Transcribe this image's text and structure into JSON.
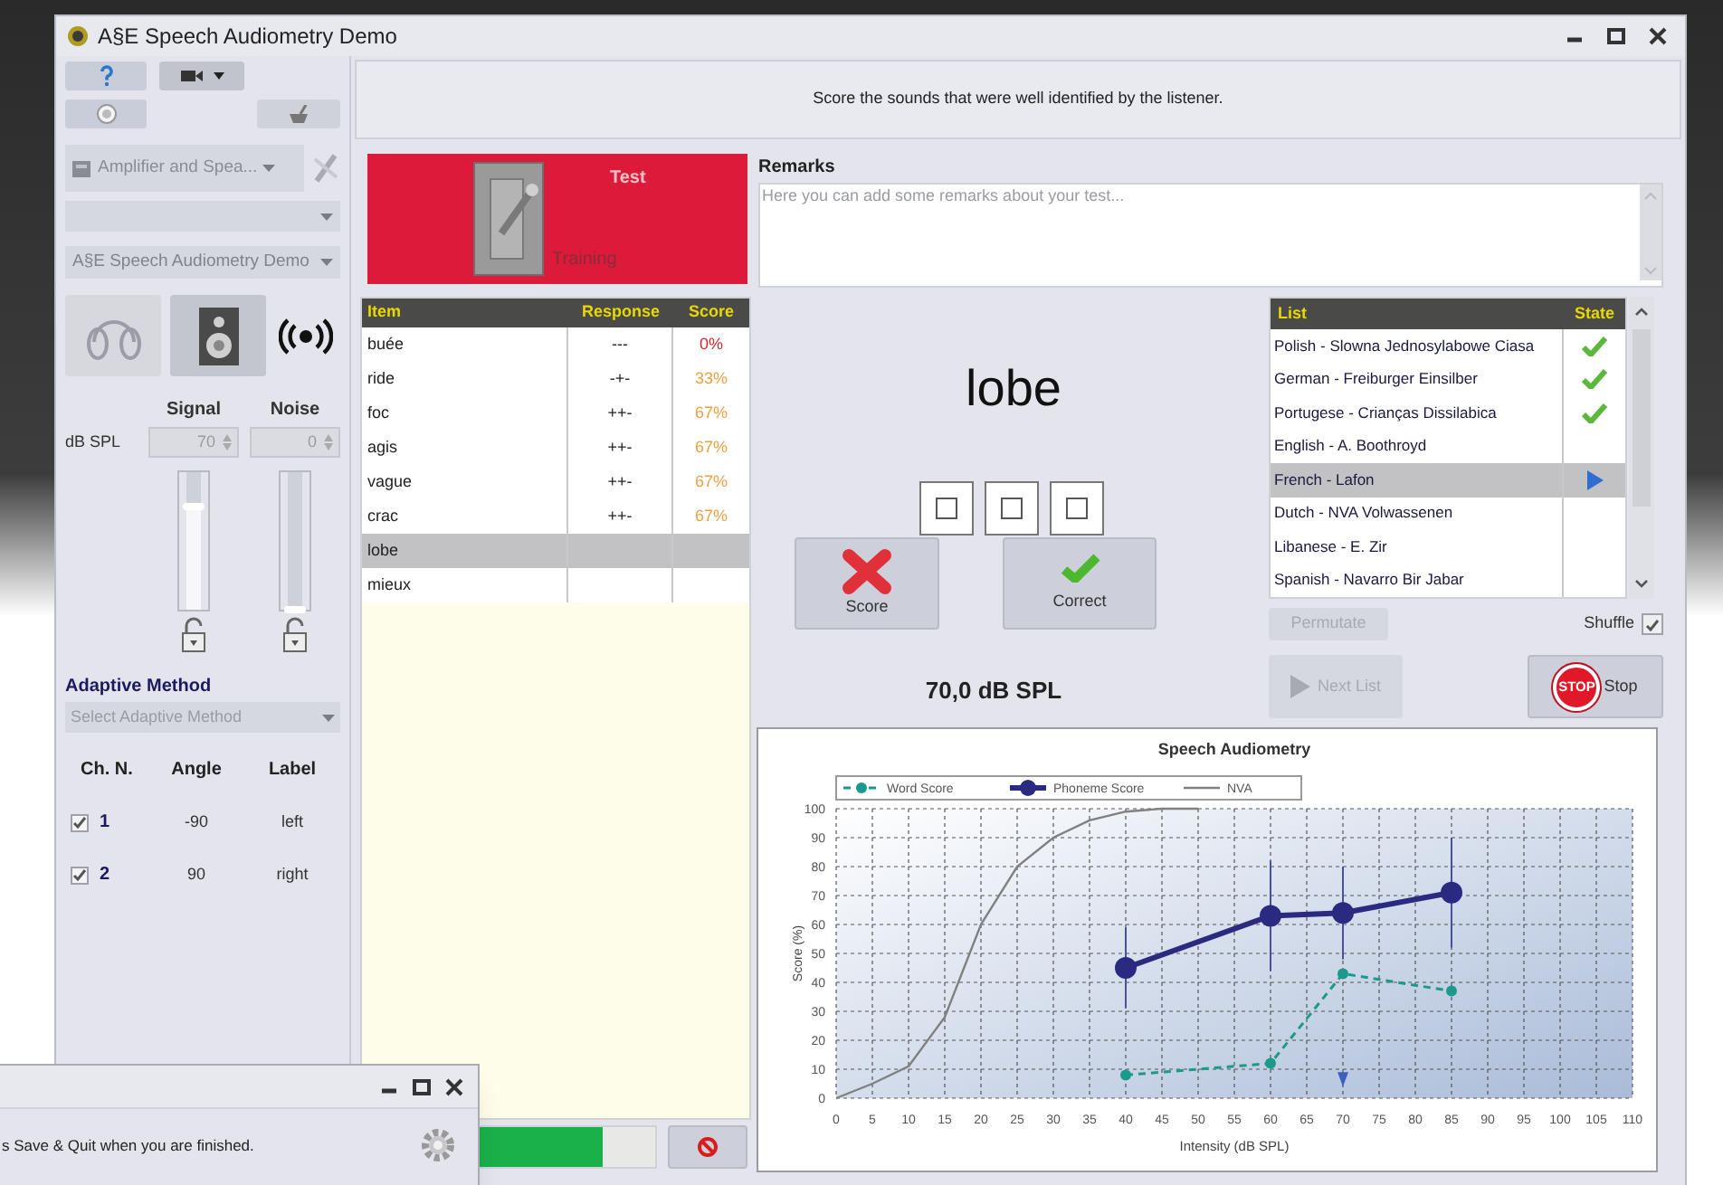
{
  "window": {
    "title": "A§E Speech Audiometry Demo"
  },
  "instruction": "Score the sounds that were well identified by the listener.",
  "left_panel": {
    "device_dropdown": "Amplifier and Spea...",
    "profile_dropdown": "A§E Speech Audiometry Demo",
    "outputs": [
      {
        "kind": "headphones",
        "selected": false
      },
      {
        "kind": "speaker",
        "selected": true
      }
    ],
    "levels": {
      "unit": "dB SPL",
      "channels": [
        {
          "label": "Signal",
          "value": "70",
          "level": 0.75
        },
        {
          "label": "Noise",
          "value": "0",
          "level": 0
        }
      ]
    },
    "adaptive_method": {
      "label": "Adaptive Method",
      "placeholder": "Select Adaptive Method"
    },
    "channel_table": {
      "columns": [
        "Ch. N.",
        "Angle",
        "Label"
      ],
      "rows": [
        {
          "checked": true,
          "number": "1",
          "angle": "-90",
          "label": "left"
        },
        {
          "checked": true,
          "number": "2",
          "angle": "90",
          "label": "right"
        }
      ]
    }
  },
  "mode_switch": {
    "options": [
      {
        "label": "Test",
        "selected": true
      },
      {
        "label": "Training",
        "selected": false
      }
    ]
  },
  "remarks": {
    "label": "Remarks",
    "placeholder": "Here you can add some remarks about your test..."
  },
  "items": {
    "columns": [
      "Item",
      "Response",
      "Score"
    ],
    "rows": [
      {
        "item": "buée",
        "response": "---",
        "score": "0%",
        "color": "#d42a2a",
        "selected": false
      },
      {
        "item": "ride",
        "response": "-+-",
        "score": "33%",
        "color": "#f0a040",
        "selected": false
      },
      {
        "item": "foc",
        "response": "++-",
        "score": "67%",
        "color": "#f0a040",
        "selected": false
      },
      {
        "item": "agis",
        "response": "++-",
        "score": "67%",
        "color": "#f0a040",
        "selected": false
      },
      {
        "item": "vague",
        "response": "++-",
        "score": "67%",
        "color": "#f0a040",
        "selected": false
      },
      {
        "item": "crac",
        "response": "++-",
        "score": "67%",
        "color": "#f0a040",
        "selected": false
      },
      {
        "item": "lobe",
        "selected": true
      },
      {
        "item": "mieux",
        "selected": false
      }
    ]
  },
  "progress": {
    "level": 0.82
  },
  "current_word": "lobe",
  "phoneme_boxes": [
    {
      "checked": false
    },
    {
      "checked": false
    },
    {
      "checked": false
    }
  ],
  "score_button": "Score",
  "correct_button": "Correct",
  "intensity": "70,0 dB SPL",
  "lists": {
    "columns": [
      "List",
      "State"
    ],
    "rows": [
      {
        "name": "Polish - Slowna Jednosylabowe Ciasa",
        "done": true,
        "current": false,
        "selected": false
      },
      {
        "name": "German - Freiburger Einsilber",
        "done": true,
        "current": false,
        "selected": false
      },
      {
        "name": "Portugese - Crianças Dissilabica",
        "done": true,
        "current": false,
        "selected": false
      },
      {
        "name": "English - A. Boothroyd",
        "done": false,
        "current": false,
        "selected": false
      },
      {
        "name": "French - Lafon",
        "done": false,
        "current": true,
        "selected": true
      },
      {
        "name": "Dutch - NVA Volwassenen",
        "done": false,
        "current": false,
        "selected": false
      },
      {
        "name": "Libanese - E. Zir",
        "done": false,
        "current": false,
        "selected": false
      },
      {
        "name": "Spanish - Navarro Bir Jabar",
        "done": false,
        "current": false,
        "selected": false
      }
    ]
  },
  "permutate": {
    "label": "Permutate",
    "disabled": true
  },
  "shuffle": {
    "label": "Shuffle",
    "checked": true
  },
  "next_list": {
    "label": "Next List",
    "disabled": true
  },
  "stop": {
    "label": "Stop",
    "sign": "STOP"
  },
  "chart": {
    "chart_data": {
      "type": "line",
      "title": "Speech Audiometry",
      "xlabel": "Intensity (dB SPL)",
      "ylabel": "Score (%)",
      "x": [
        0,
        5,
        10,
        15,
        20,
        25,
        30,
        35,
        40,
        45,
        50,
        60,
        70,
        85
      ],
      "series": [
        {
          "name": "Word Score",
          "color": "#1a9a8a",
          "line_style": "dashed",
          "marker": "circle",
          "values": [
            null,
            null,
            null,
            null,
            null,
            null,
            null,
            null,
            8,
            null,
            null,
            12,
            43,
            37
          ]
        },
        {
          "name": "Phoneme Score",
          "color": "#2a2a80",
          "line_style": "solid",
          "marker": "circle",
          "values": [
            null,
            null,
            null,
            null,
            null,
            null,
            null,
            null,
            45,
            null,
            null,
            63,
            64,
            71
          ],
          "errors": [
            null,
            null,
            null,
            null,
            null,
            null,
            null,
            null,
            14,
            null,
            null,
            19,
            16,
            19
          ]
        },
        {
          "name": "NVA",
          "color": "#808080",
          "line_style": "solid",
          "marker": "none",
          "values": [
            0,
            5,
            11,
            28,
            60,
            80,
            90,
            96,
            99,
            100,
            100,
            null,
            null,
            null
          ]
        }
      ],
      "grid": true,
      "legend": "top",
      "xlim": [
        0,
        110
      ],
      "ylim": [
        0,
        100
      ],
      "xticks": [
        {
          "value": 0,
          "label": "0"
        },
        {
          "value": 5,
          "label": "5"
        },
        {
          "value": 10,
          "label": "10"
        },
        {
          "value": 15,
          "label": "15"
        },
        {
          "value": 20,
          "label": "20"
        },
        {
          "value": 25,
          "label": "25"
        },
        {
          "value": 30,
          "label": "30"
        },
        {
          "value": 35,
          "label": "35"
        },
        {
          "value": 40,
          "label": "40"
        },
        {
          "value": 45,
          "label": "45"
        },
        {
          "value": 50,
          "label": "50"
        },
        {
          "value": 55,
          "label": "55"
        },
        {
          "value": 60,
          "label": "60"
        },
        {
          "value": 65,
          "label": "65"
        },
        {
          "value": 70,
          "label": "70"
        },
        {
          "value": 75,
          "label": "75"
        },
        {
          "value": 80,
          "label": "80"
        },
        {
          "value": 85,
          "label": "85"
        },
        {
          "value": 90,
          "label": "90"
        },
        {
          "value": 95,
          "label": "95"
        },
        {
          "value": 100,
          "label": "100"
        },
        {
          "value": 105,
          "label": "105"
        },
        {
          "value": 110,
          "label": "110"
        }
      ],
      "yticks": [
        {
          "value": 0,
          "label": "0"
        },
        {
          "value": 10,
          "label": "10"
        },
        {
          "value": 20,
          "label": "20"
        },
        {
          "value": 30,
          "label": "30"
        },
        {
          "value": 40,
          "label": "40"
        },
        {
          "value": 50,
          "label": "50"
        },
        {
          "value": 60,
          "label": "60"
        },
        {
          "value": 70,
          "label": "70"
        },
        {
          "value": 80,
          "label": "80"
        },
        {
          "value": 90,
          "label": "90"
        },
        {
          "value": 100,
          "label": "100"
        }
      ]
    }
  },
  "popup": {
    "message": "s Save & Quit when you are finished."
  }
}
